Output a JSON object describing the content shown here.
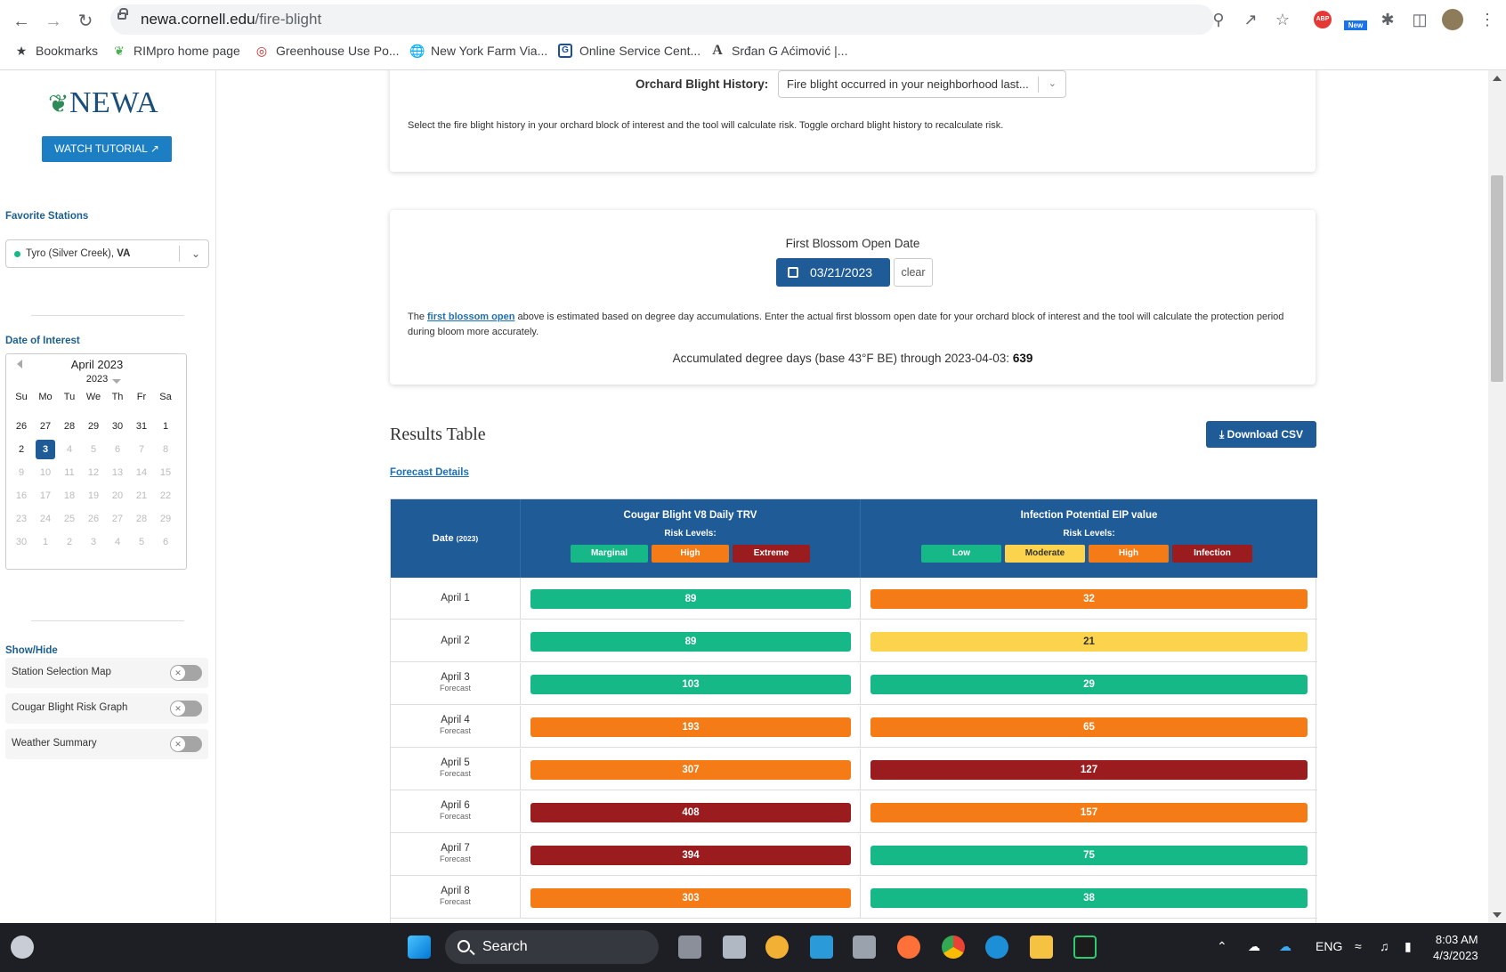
{
  "browser": {
    "url_host": "newa.cornell.edu",
    "url_path": "/fire-blight",
    "bookmarks": [
      {
        "label": "Bookmarks",
        "icon": "star-icon"
      },
      {
        "label": "RIMpro home page",
        "icon": "leaf-icon"
      },
      {
        "label": "Greenhouse Use Po...",
        "icon": "shield-icon"
      },
      {
        "label": "New York Farm Via...",
        "icon": "globe-icon"
      },
      {
        "label": "Online Service Cent...",
        "icon": "g-logo-icon"
      },
      {
        "label": "Srđan G Aćimović |...",
        "icon": "a-letter-icon"
      }
    ],
    "ext_new_badge": "New",
    "abp_badge": "ABP"
  },
  "sidebar": {
    "logo": "NEWA",
    "tutorial_label": "WATCH TUTORIAL",
    "favorite_heading": "Favorite Stations",
    "station_name": "Tyro (Silver Creek),",
    "station_state": "VA",
    "doi_heading": "Date of Interest",
    "calendar": {
      "month": "April 2023",
      "year": "2023",
      "weekdays": [
        "Su",
        "Mo",
        "Tu",
        "We",
        "Th",
        "Fr",
        "Sa"
      ],
      "weeks": [
        [
          "26",
          "27",
          "28",
          "29",
          "30",
          "31",
          "1"
        ],
        [
          "2",
          "3",
          "4",
          "5",
          "6",
          "7",
          "8"
        ],
        [
          "9",
          "10",
          "11",
          "12",
          "13",
          "14",
          "15"
        ],
        [
          "16",
          "17",
          "18",
          "19",
          "20",
          "21",
          "22"
        ],
        [
          "23",
          "24",
          "25",
          "26",
          "27",
          "28",
          "29"
        ],
        [
          "30",
          "1",
          "2",
          "3",
          "4",
          "5",
          "6"
        ]
      ],
      "selected": "3"
    },
    "showhide_heading": "Show/Hide",
    "toggles": [
      "Station Selection Map",
      "Cougar Blight Risk Graph",
      "Weather Summary"
    ]
  },
  "history": {
    "label": "Orchard Blight History:",
    "value": "Fire blight occurred in your neighborhood last...",
    "help": "Select the fire blight history in your orchard block of interest and the tool will calculate risk. Toggle orchard blight history to recalculate risk."
  },
  "blossom": {
    "title": "First Blossom Open Date",
    "date": "03/21/2023",
    "clear": "clear",
    "text_pre": "The ",
    "text_link": "first blossom open",
    "text_post": " above is estimated based on degree day accumulations. Enter the actual first blossom open date for your orchard block of interest and the tool will calculate the protection period during bloom more accurately.",
    "accum_label": "Accumulated degree days (base 43°F BE) through 2023-04-03:",
    "accum_value": "639"
  },
  "results": {
    "title": "Results Table",
    "csv_label": "Download CSV",
    "forecast_link": "Forecast Details",
    "date_header": "Date",
    "date_year": "(2023)",
    "cougar_header": "Cougar Blight V8 Daily TRV",
    "eip_header": "Infection Potential EIP value",
    "risk_levels_label": "Risk Levels:",
    "cougar_levels": [
      {
        "label": "Marginal",
        "color": "#15b886",
        "text": "#ffffff"
      },
      {
        "label": "High",
        "color": "#f47b16",
        "text": "#ffffff"
      },
      {
        "label": "Extreme",
        "color": "#9b1c1f",
        "text": "#ffffff"
      }
    ],
    "eip_levels": [
      {
        "label": "Low",
        "color": "#15b886",
        "text": "#ffffff"
      },
      {
        "label": "Moderate",
        "color": "#fcd34d",
        "text": "#333333"
      },
      {
        "label": "High",
        "color": "#f47b16",
        "text": "#ffffff"
      },
      {
        "label": "Infection",
        "color": "#9b1c1f",
        "text": "#ffffff"
      }
    ],
    "rows": [
      {
        "date": "April 1",
        "forecast": "",
        "trv": "89",
        "trv_level": "Marginal",
        "eip": "32",
        "eip_level": "High"
      },
      {
        "date": "April 2",
        "forecast": "",
        "trv": "89",
        "trv_level": "Marginal",
        "eip": "21",
        "eip_level": "Moderate"
      },
      {
        "date": "April 3",
        "forecast": "Forecast",
        "trv": "103",
        "trv_level": "Marginal",
        "eip": "29",
        "eip_level": "Low"
      },
      {
        "date": "April 4",
        "forecast": "Forecast",
        "trv": "193",
        "trv_level": "High",
        "eip": "65",
        "eip_level": "High"
      },
      {
        "date": "April 5",
        "forecast": "Forecast",
        "trv": "307",
        "trv_level": "High",
        "eip": "127",
        "eip_level": "Infection"
      },
      {
        "date": "April 6",
        "forecast": "Forecast",
        "trv": "408",
        "trv_level": "Extreme",
        "eip": "157",
        "eip_level": "High"
      },
      {
        "date": "April 7",
        "forecast": "Forecast",
        "trv": "394",
        "trv_level": "Extreme",
        "eip": "75",
        "eip_level": "Low"
      },
      {
        "date": "April 8",
        "forecast": "Forecast",
        "trv": "303",
        "trv_level": "High",
        "eip": "38",
        "eip_level": "Low"
      }
    ]
  },
  "taskbar": {
    "search_label": "Search",
    "lang": "ENG",
    "time": "8:03 AM",
    "date": "4/3/2023"
  }
}
